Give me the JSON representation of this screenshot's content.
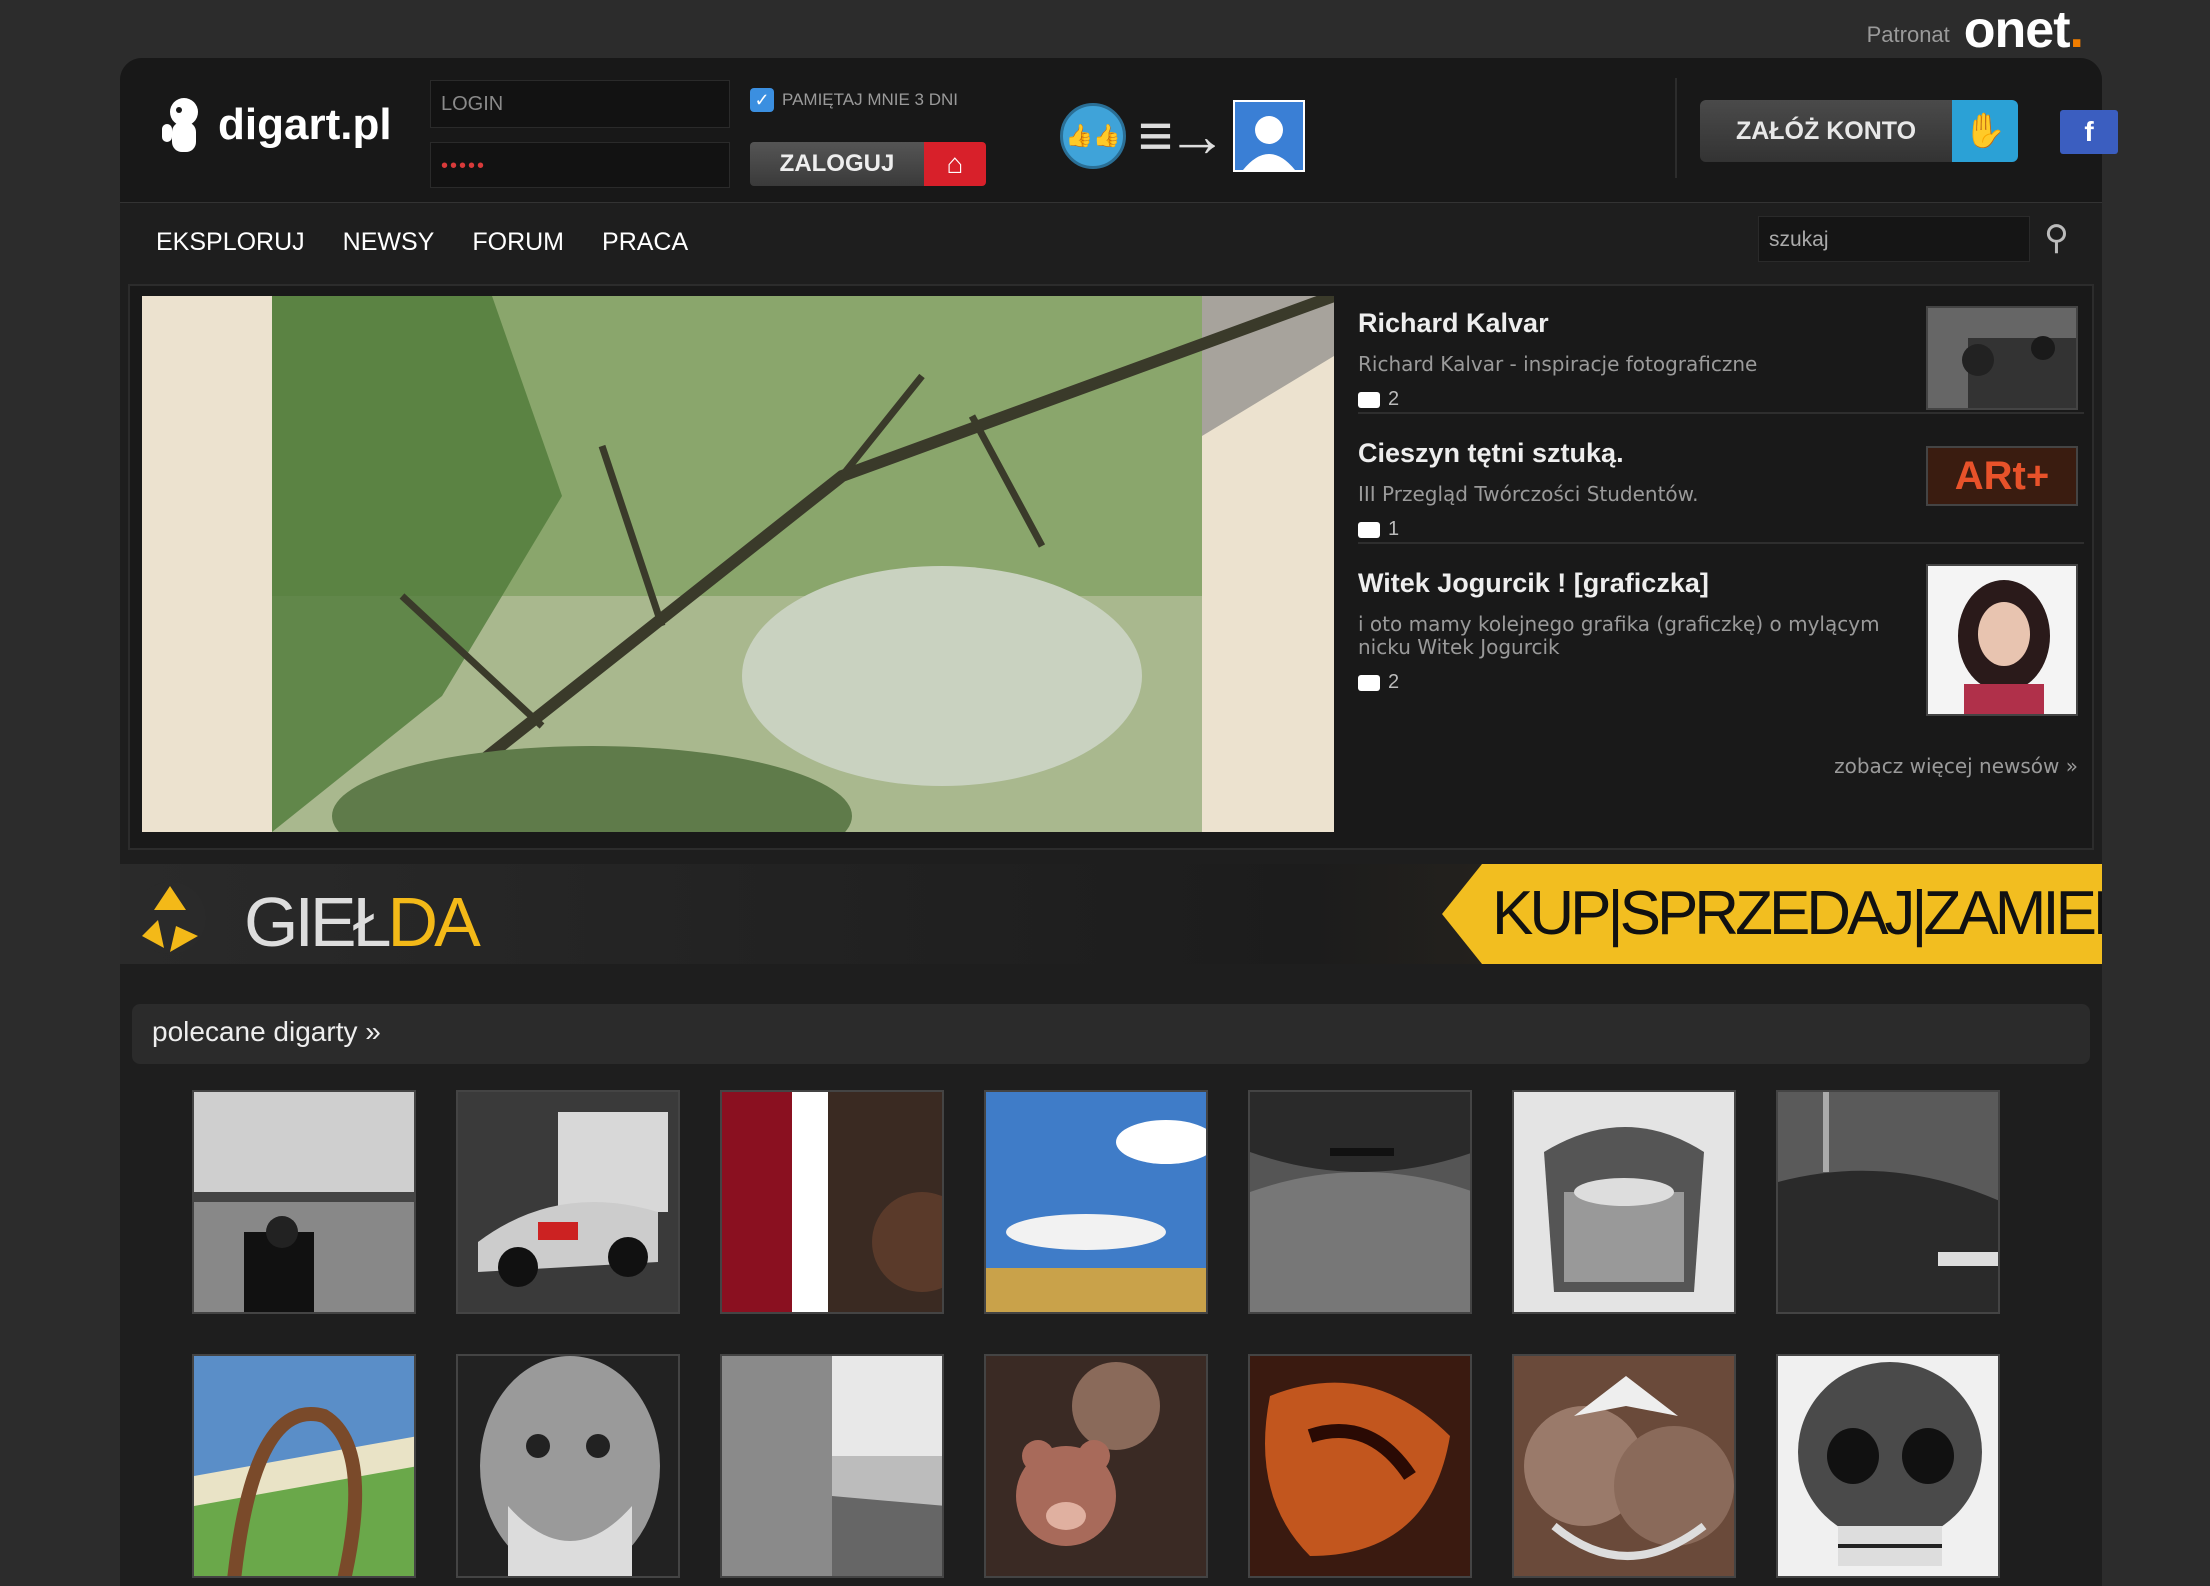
{
  "patron": {
    "label": "Patronat",
    "brand": "onet",
    "brand_dot": "."
  },
  "logo": {
    "text": "digart.pl"
  },
  "login": {
    "login_placeholder": "LOGIN",
    "password_mask": "•••••",
    "remember_label": "PAMIĘTAJ MNIE 3 DNI",
    "login_button": "ZALOGUJ"
  },
  "header": {
    "register_button": "ZAŁÓŻ KONTO",
    "facebook": "f"
  },
  "nav": {
    "items": [
      "EKSPLORUJ",
      "NEWSY",
      "FORUM",
      "PRACA"
    ],
    "search_placeholder": "szukaj"
  },
  "news": [
    {
      "title": "Richard Kalvar",
      "subtitle": "Richard Kalvar - inspiracje fotograficzne",
      "comments": "2"
    },
    {
      "title": "Cieszyn tętni sztuką.",
      "subtitle": "III Przegląd Twórczości Studentów.",
      "comments": "1"
    },
    {
      "title": "Witek Jogurcik ! [graficzka]",
      "subtitle": "i oto mamy kolejnego grafika (graficzkę) o mylącym nicku Witek Jogurcik",
      "comments": "2"
    }
  ],
  "more_news": "zobacz więcej newsów »",
  "art_thumb_text": "ARt+",
  "gielda": {
    "name_a": "GIEŁ",
    "name_b": "DA",
    "banner": "KUP|SPRZEDAJ|ZAMIEŃ"
  },
  "polecane": {
    "title": "polecane digarty »"
  },
  "colors": {
    "accent_red": "#d8202a",
    "accent_blue": "#2ba1d6",
    "gielda_yellow": "#f2be20",
    "onet_orange": "#f07d00"
  }
}
